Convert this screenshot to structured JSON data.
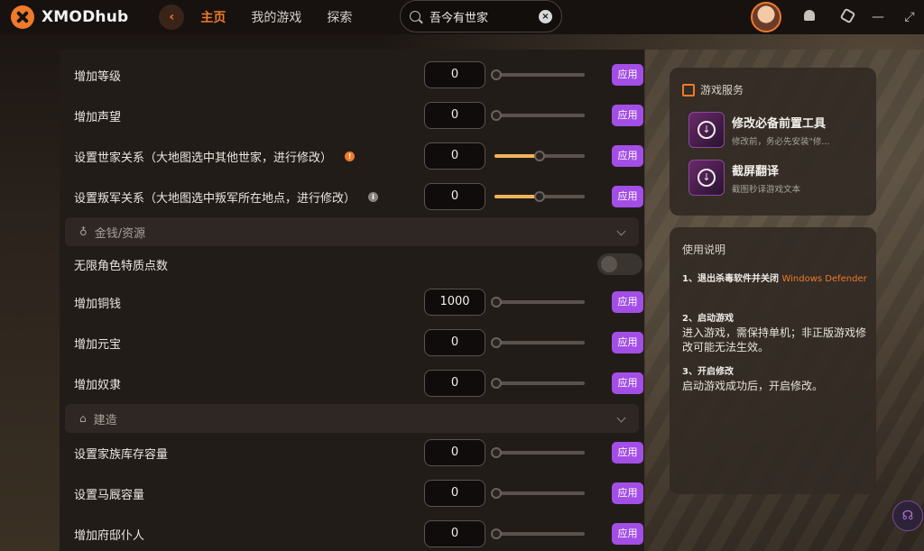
{
  "app": {
    "logo_text": "XMODhub",
    "back_icon": "arrow-left-icon"
  },
  "nav": {
    "home": "主页",
    "my_games": "我的游戏",
    "explore": "探索"
  },
  "search": {
    "value": "吾今有世家",
    "clear_icon": "close-icon"
  },
  "rows": {
    "add_level": {
      "label": "增加等级",
      "value": "0",
      "slider": 0
    },
    "add_fame": {
      "label": "增加声望",
      "value": "0",
      "slider": 0
    },
    "family_relation": {
      "label": "设置世家关系（大地图选中其他世家，进行修改）",
      "value": "0",
      "slider": 0.5
    },
    "rebel_relation": {
      "label": "设置叛军关系（大地图选中叛军所在地点，进行修改）",
      "value": "0",
      "slider": 0.5
    },
    "unlimited_trait": {
      "label": "无限角色特质点数",
      "enabled": false
    },
    "add_copper": {
      "label": "增加铜钱",
      "value": "1000",
      "slider": 0
    },
    "add_yuanbao": {
      "label": "增加元宝",
      "value": "0",
      "slider": 0
    },
    "add_slave": {
      "label": "增加奴隶",
      "value": "0",
      "slider": 0
    },
    "storage_capacity": {
      "label": "设置家族库存容量",
      "value": "0",
      "slider": 0
    },
    "stable_capacity": {
      "label": "设置马厩容量",
      "value": "0",
      "slider": 0
    },
    "add_servant": {
      "label": "增加府邸仆人",
      "value": "0",
      "slider": 0
    }
  },
  "apply_label": "应用",
  "sections": {
    "money": "金钱/资源",
    "build": "建造"
  },
  "service": {
    "title": "游戏服务",
    "items": [
      {
        "name": "修改必备前置工具",
        "desc": "修改前，务必先安装\"修..."
      },
      {
        "name": "截屏翻译",
        "desc": "截图秒译游戏文本"
      }
    ]
  },
  "guide": {
    "title": "使用说明",
    "step1_title": "1、退出杀毒软件并关闭",
    "step1_highlight": "Windows Defender",
    "step2_title": "2、启动游戏",
    "step2_body": "进入游戏，需保持单机；非正版游戏修改可能无法生效。",
    "step3_title": "3、开启修改",
    "step3_body": "启动游戏成功后，开启修改。"
  },
  "colors": {
    "accent": "#f07a2a",
    "apply": "#a34ee6"
  }
}
